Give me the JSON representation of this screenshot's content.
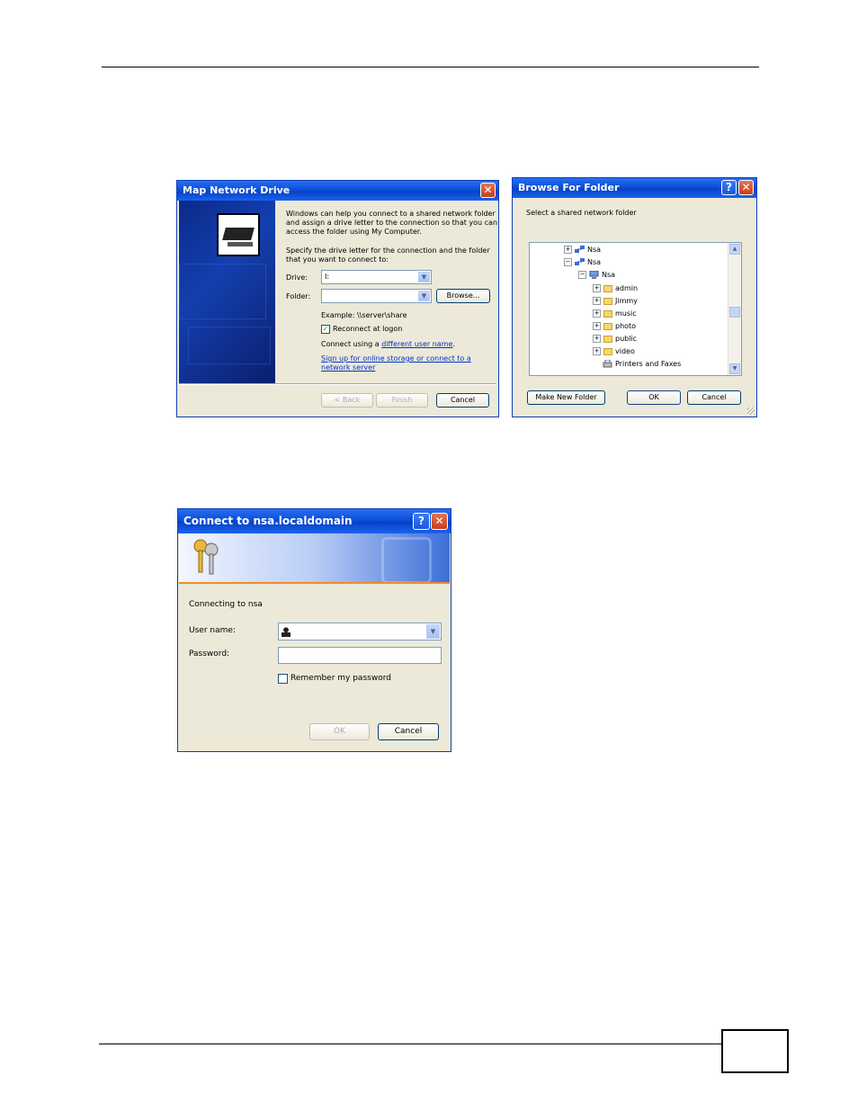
{
  "map_drive": {
    "title": "Map Network Drive",
    "close_glyph": "✕",
    "intro": [
      "Windows can help you connect to a shared network folder",
      "and assign a drive letter to the connection so that you can",
      "access the folder using My Computer."
    ],
    "specify": [
      "Specify the drive letter for the connection and the folder",
      "that you want to connect to:"
    ],
    "drive_label": "Drive:",
    "drive_value": "I:",
    "folder_label": "Folder:",
    "folder_value": "",
    "browse_button": "Browse...",
    "example": "Example: \\\\server\\share",
    "reconnect_label": "Reconnect at logon",
    "reconnect_checked": "✓",
    "connect_using": "Connect using a ",
    "different_user": "different user name",
    "period": ".",
    "signup_line1": "Sign up for online storage or connect to a",
    "signup_line2": "network server",
    "back_button": "< Back",
    "finish_button": "Finish",
    "cancel_button": "Cancel"
  },
  "browse_folder": {
    "title": "Browse For Folder",
    "help_glyph": "?",
    "close_glyph": "✕",
    "prompt": "Select a shared network folder",
    "tree": [
      {
        "label": "Nsa",
        "expander": "+"
      },
      {
        "label": "Nsa",
        "expander": "−"
      },
      {
        "label": "Nsa",
        "expander": "−"
      },
      {
        "label": "admin",
        "expander": "+"
      },
      {
        "label": "Jimmy",
        "expander": "+"
      },
      {
        "label": "music",
        "expander": "+"
      },
      {
        "label": "photo",
        "expander": "+"
      },
      {
        "label": "public",
        "expander": "+"
      },
      {
        "label": "video",
        "expander": "+"
      },
      {
        "label": "Printers and Faxes"
      }
    ],
    "make_new_folder": "Make New Folder",
    "ok_button": "OK",
    "cancel_button": "Cancel"
  },
  "connect": {
    "title": "Connect to nsa.localdomain",
    "help_glyph": "?",
    "close_glyph": "✕",
    "connecting": "Connecting to nsa",
    "username_label": "User name:",
    "username_value": "",
    "password_label": "Password:",
    "password_value": "",
    "remember_label": "Remember my password",
    "ok_button": "OK",
    "cancel_button": "Cancel"
  },
  "colors": {
    "xp_blue": "#0a4fd8",
    "dialog_bg": "#ece9d8",
    "close_red": "#c83d1a",
    "link": "#0033cc"
  }
}
